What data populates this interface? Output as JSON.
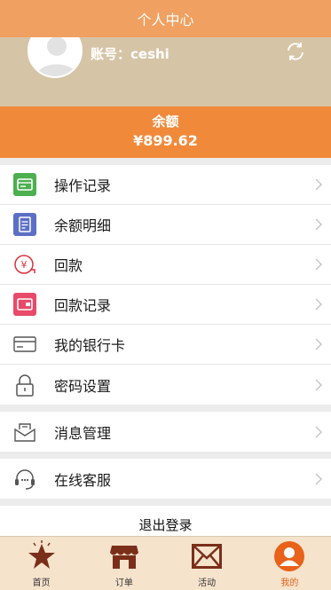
{
  "header": {
    "title": "个人中心"
  },
  "profile": {
    "account_text": "账号：ceshi"
  },
  "balance": {
    "label": "余额",
    "value": "¥899.62"
  },
  "menu_group_1": [
    {
      "label": "操作记录",
      "icon": "operation-record-icon",
      "color": "#4caf50"
    },
    {
      "label": "余额明细",
      "icon": "balance-detail-icon",
      "color": "#5b6fc4"
    },
    {
      "label": "回款",
      "icon": "repayment-icon",
      "color": "#d8323f"
    },
    {
      "label": "回款记录",
      "icon": "repayment-record-icon",
      "color": "#e84a6a"
    },
    {
      "label": "我的银行卡",
      "icon": "bank-card-icon",
      "color": "#555555"
    },
    {
      "label": "密码设置",
      "icon": "lock-icon",
      "color": "#555555"
    }
  ],
  "menu_group_2": [
    {
      "label": "消息管理",
      "icon": "message-icon",
      "color": "#555555"
    }
  ],
  "menu_group_3": [
    {
      "label": "在线客服",
      "icon": "headset-icon",
      "color": "#555555"
    }
  ],
  "logout": {
    "label": "退出登录"
  },
  "tabbar": [
    {
      "label": "首页",
      "icon": "home-star-icon",
      "active": false
    },
    {
      "label": "订单",
      "icon": "shop-icon",
      "active": false
    },
    {
      "label": "活动",
      "icon": "mail-icon",
      "active": false
    },
    {
      "label": "我的",
      "icon": "user-icon",
      "active": true
    }
  ],
  "colors": {
    "header": "#f0a060",
    "balance": "#f08a3a",
    "profile_bg": "#d6c4a6",
    "tab_active": "#e8621a",
    "tab_icon": "#7a2f1a"
  }
}
